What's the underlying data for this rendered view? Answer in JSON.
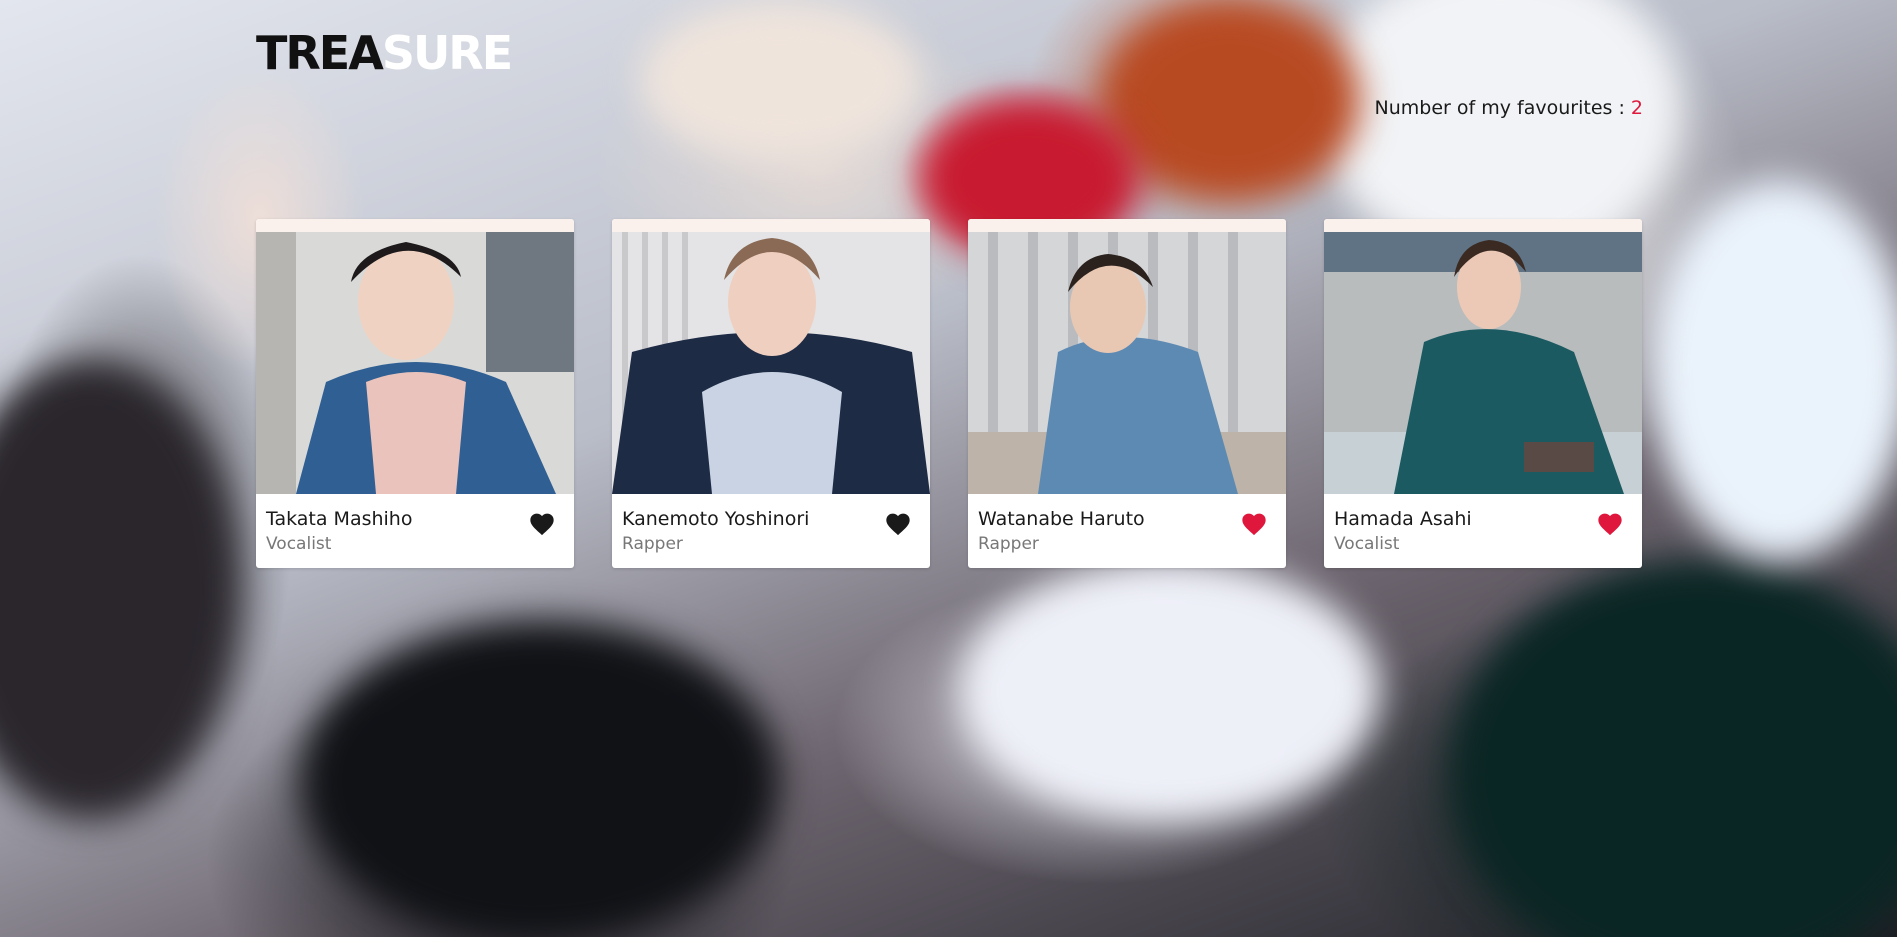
{
  "header": {
    "logo_dark": "TREA",
    "logo_light": "SURE"
  },
  "favourites": {
    "label": "Number of my favourites : ",
    "count": "2",
    "count_color": "#e0173c"
  },
  "colors": {
    "heart_active": "#e0173c",
    "heart_inactive": "#1a1a1a"
  },
  "members": [
    {
      "name": "Takata Mashiho",
      "role": "Vocalist",
      "favourite": false,
      "icon": "heart-icon"
    },
    {
      "name": "Kanemoto Yoshinori",
      "role": "Rapper",
      "favourite": false,
      "icon": "heart-icon"
    },
    {
      "name": "Watanabe Haruto",
      "role": "Rapper",
      "favourite": true,
      "icon": "heart-icon"
    },
    {
      "name": "Hamada Asahi",
      "role": "Vocalist",
      "favourite": true,
      "icon": "heart-icon"
    }
  ]
}
